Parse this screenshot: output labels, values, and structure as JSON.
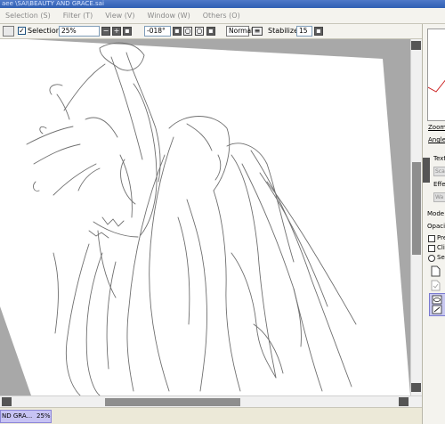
{
  "window": {
    "title": "aee \\SAI\\BEAUTY AND GRACE.sai"
  },
  "menubar": {
    "items": [
      {
        "label": "Selection (S)"
      },
      {
        "label": "Filter (T)"
      },
      {
        "label": "View (V)"
      },
      {
        "label": "Window (W)"
      },
      {
        "label": "Others (O)"
      }
    ]
  },
  "toolbar": {
    "selection_label": "Selection",
    "zoom_value": "25%",
    "angle_value": "-018°",
    "blend_mode": "Normal",
    "stabilizer_label": "Stabilizer",
    "stabilizer_value": "15"
  },
  "document_tab": {
    "name": "ND GRA...",
    "zoom": "25%"
  },
  "right_panel": {
    "zoom_label": "Zoom",
    "angle_label": "Angle",
    "texture_label": "Text",
    "texture_value": "Sca",
    "effect_label": "Effe",
    "effect_value": "Wa",
    "mode_label": "Mode",
    "opacity_label": "Opaci",
    "preserve_label": "Pre",
    "clipping_label": "Clip",
    "selection_source_label": "Sel"
  },
  "colors": {
    "canvas_background": "#a8a8a8",
    "paper": "#ffffff",
    "title_bar": "#2f5fb3",
    "document_tab": "#c7c3f4",
    "navigator_frame": "#cc2222"
  }
}
